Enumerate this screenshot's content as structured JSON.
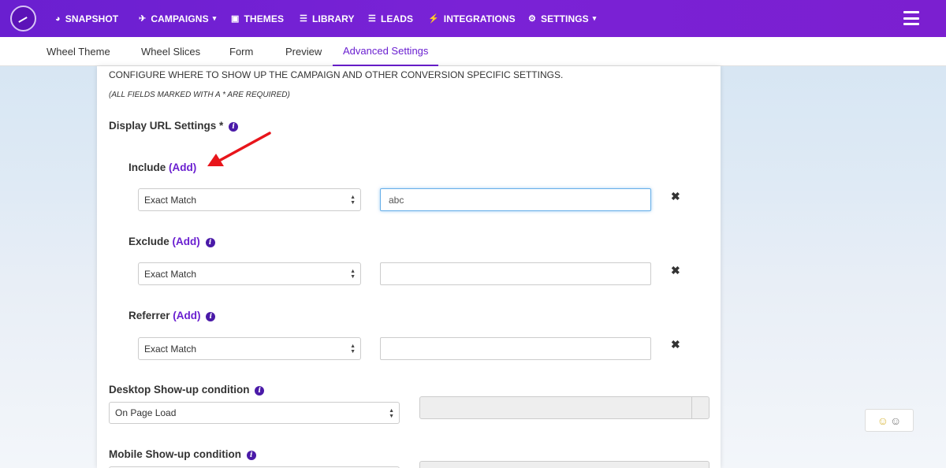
{
  "nav": {
    "items": [
      {
        "label": "SNAPSHOT",
        "icon": "dashboard-icon",
        "glyph": "◕"
      },
      {
        "label": "CAMPAIGNS",
        "icon": "paper-plane-icon",
        "glyph": "✈",
        "caret": "▾"
      },
      {
        "label": "THEMES",
        "icon": "image-icon",
        "glyph": "▣"
      },
      {
        "label": "LIBRARY",
        "icon": "list-icon",
        "glyph": "☰"
      },
      {
        "label": "LEADS",
        "icon": "list-icon",
        "glyph": "☰"
      },
      {
        "label": "INTEGRATIONS",
        "icon": "plug-icon",
        "glyph": "⚡"
      },
      {
        "label": "SETTINGS",
        "icon": "cogs-icon",
        "glyph": "⚙",
        "caret": "▾"
      }
    ]
  },
  "tabs": [
    "Wheel Theme",
    "Wheel Slices",
    "Form",
    "Preview",
    "Advanced Settings"
  ],
  "active_tab": "Advanced Settings",
  "main": {
    "config_text": "CONFIGURE WHERE TO SHOW UP THE CAMPAIGN AND OTHER CONVERSION SPECIFIC SETTINGS.",
    "required_note": "(ALL FIELDS MARKED WITH A * ARE REQUIRED)",
    "display_url_title": "Display URL Settings *",
    "include": {
      "label": "Include",
      "add": "(Add)",
      "match": "Exact Match",
      "value": "abc"
    },
    "exclude": {
      "label": "Exclude",
      "add": "(Add)",
      "match": "Exact Match",
      "value": ""
    },
    "referrer": {
      "label": "Referrer",
      "add": "(Add)",
      "match": "Exact Match",
      "value": ""
    },
    "remove_glyph": "✖",
    "desktop": {
      "label": "Desktop Show-up condition",
      "value": "On Page Load"
    },
    "mobile": {
      "label": "Mobile Show-up condition"
    }
  },
  "colors": {
    "brand": "#6a1fd0",
    "link": "#6a1fd0",
    "arrow": "#e8151b"
  }
}
